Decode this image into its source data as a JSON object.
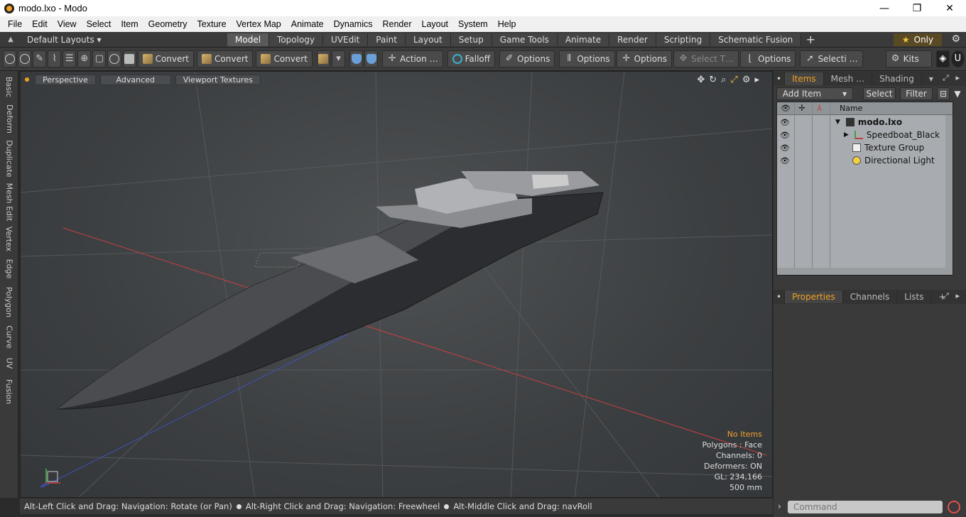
{
  "window": {
    "title": "modo.lxo - Modo",
    "minimize": "—",
    "maximize": "❐",
    "close": "✕"
  },
  "menu": [
    "File",
    "Edit",
    "View",
    "Select",
    "Item",
    "Geometry",
    "Texture",
    "Vertex Map",
    "Animate",
    "Dynamics",
    "Render",
    "Layout",
    "System",
    "Help"
  ],
  "layoutbar": {
    "layouts_label": "Default Layouts ▾",
    "tabs": [
      "Model",
      "Topology",
      "UVEdit",
      "Paint",
      "Layout",
      "Setup",
      "Game Tools",
      "Animate",
      "Render",
      "Scripting",
      "Schematic Fusion"
    ],
    "active_tab": "Model",
    "only_label": "Only"
  },
  "toolbar": {
    "convert1": "Convert",
    "convert2": "Convert",
    "convert3": "Convert",
    "action": "Action …",
    "falloff": "Falloff",
    "options1": "Options",
    "options2": "Options",
    "options3": "Options",
    "options4": "Options",
    "select_t": "Select T…",
    "selecti": "Selecti …",
    "kits": "Kits"
  },
  "lefttabs": [
    "Basic",
    "Deform",
    "Duplicate",
    "Mesh Edit",
    "Vertex",
    "Edge",
    "Polygon",
    "Curve",
    "UV",
    "Fusion"
  ],
  "viewport": {
    "perspective": "Perspective",
    "advanced": "Advanced",
    "textures": "Viewport Textures",
    "info": {
      "no_items": "No Items",
      "polygons": "Polygons : Face",
      "channels": "Channels: 0",
      "deformers": "Deformers: ON",
      "gl": "GL: 234,166",
      "size": "500 mm"
    }
  },
  "status": {
    "hint1": "Alt-Left Click and Drag: Navigation: Rotate (or Pan)",
    "hint2": "Alt-Right Click and Drag: Navigation: Freewheel",
    "hint3": "Alt-Middle Click and Drag: navRoll"
  },
  "items_panel": {
    "tabs": [
      "Items",
      "Mesh …",
      "Shading"
    ],
    "add_item": "Add Item",
    "select": "Select",
    "filter": "Filter",
    "name_header": "Name",
    "items": [
      {
        "name": "modo.lxo",
        "level": 0
      },
      {
        "name": "Speedboat_Black",
        "level": 1
      },
      {
        "name": "Texture Group",
        "level": 1
      },
      {
        "name": "Directional Light",
        "level": 1
      }
    ]
  },
  "properties_panel": {
    "tabs": [
      "Properties",
      "Channels",
      "Lists"
    ],
    "plus": "+"
  },
  "command": {
    "placeholder": "Command"
  },
  "colors": {
    "accent": "#f0a020",
    "viewport_bg": "#44474a",
    "boat_hull": "#2a2a2c",
    "deck": "#5a5c60"
  }
}
